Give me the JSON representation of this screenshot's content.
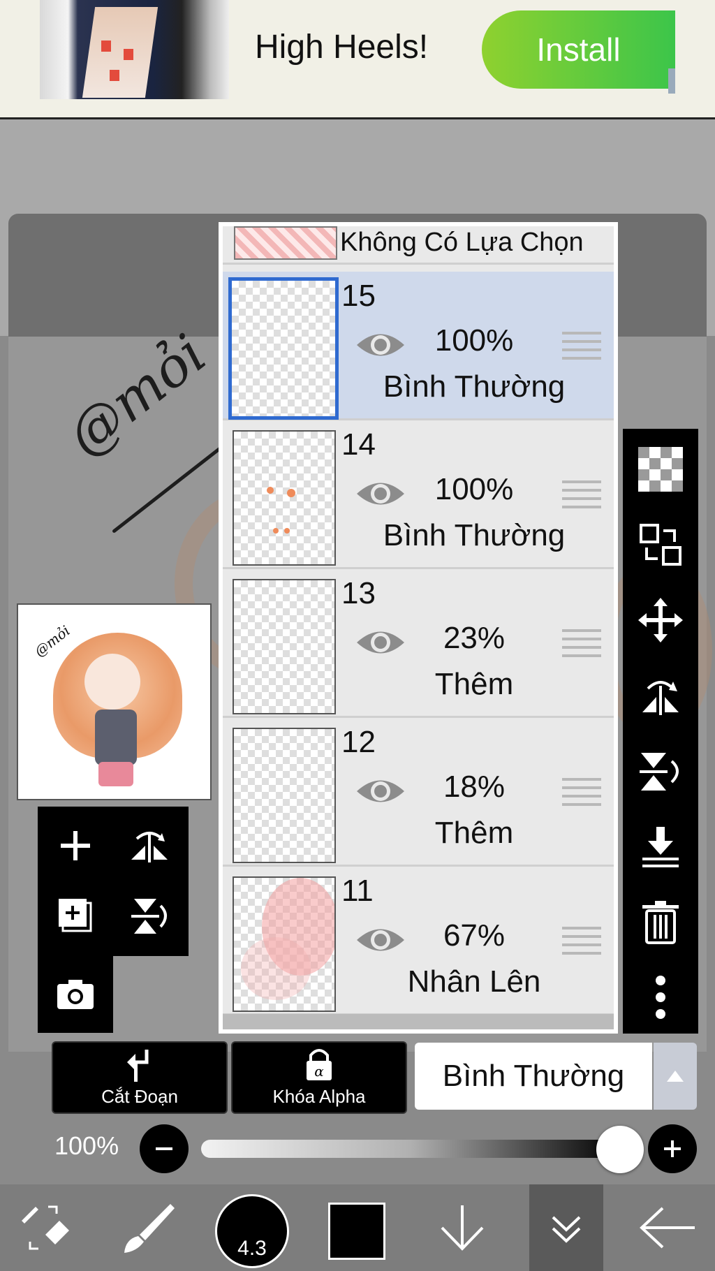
{
  "ad": {
    "title": "High Heels!",
    "install_label": "Install"
  },
  "canvas": {
    "signature_text": "@mỏi"
  },
  "layers_panel": {
    "no_selection_label": "Không Có Lựa Chọn",
    "layers": [
      {
        "number": "15",
        "opacity": "100%",
        "blend_mode": "Bình Thường",
        "selected": true
      },
      {
        "number": "14",
        "opacity": "100%",
        "blend_mode": "Bình Thường",
        "selected": false
      },
      {
        "number": "13",
        "opacity": "23%",
        "blend_mode": "Thêm",
        "selected": false
      },
      {
        "number": "12",
        "opacity": "18%",
        "blend_mode": "Thêm",
        "selected": false
      },
      {
        "number": "11",
        "opacity": "67%",
        "blend_mode": "Nhân Lên",
        "selected": false
      }
    ]
  },
  "controls": {
    "clipping_label": "Cắt Đoạn",
    "alpha_lock_label": "Khóa Alpha",
    "blend_mode_value": "Bình Thường",
    "opacity_label": "100%",
    "opacity_value": 1.0
  },
  "bottom_bar": {
    "brush_size": "4.3",
    "current_color": "#000000"
  },
  "colors": {
    "selected_layer_bg": "#cfd9eb",
    "selection_border": "#2f6ad0",
    "install_green": "#3cc54a"
  }
}
